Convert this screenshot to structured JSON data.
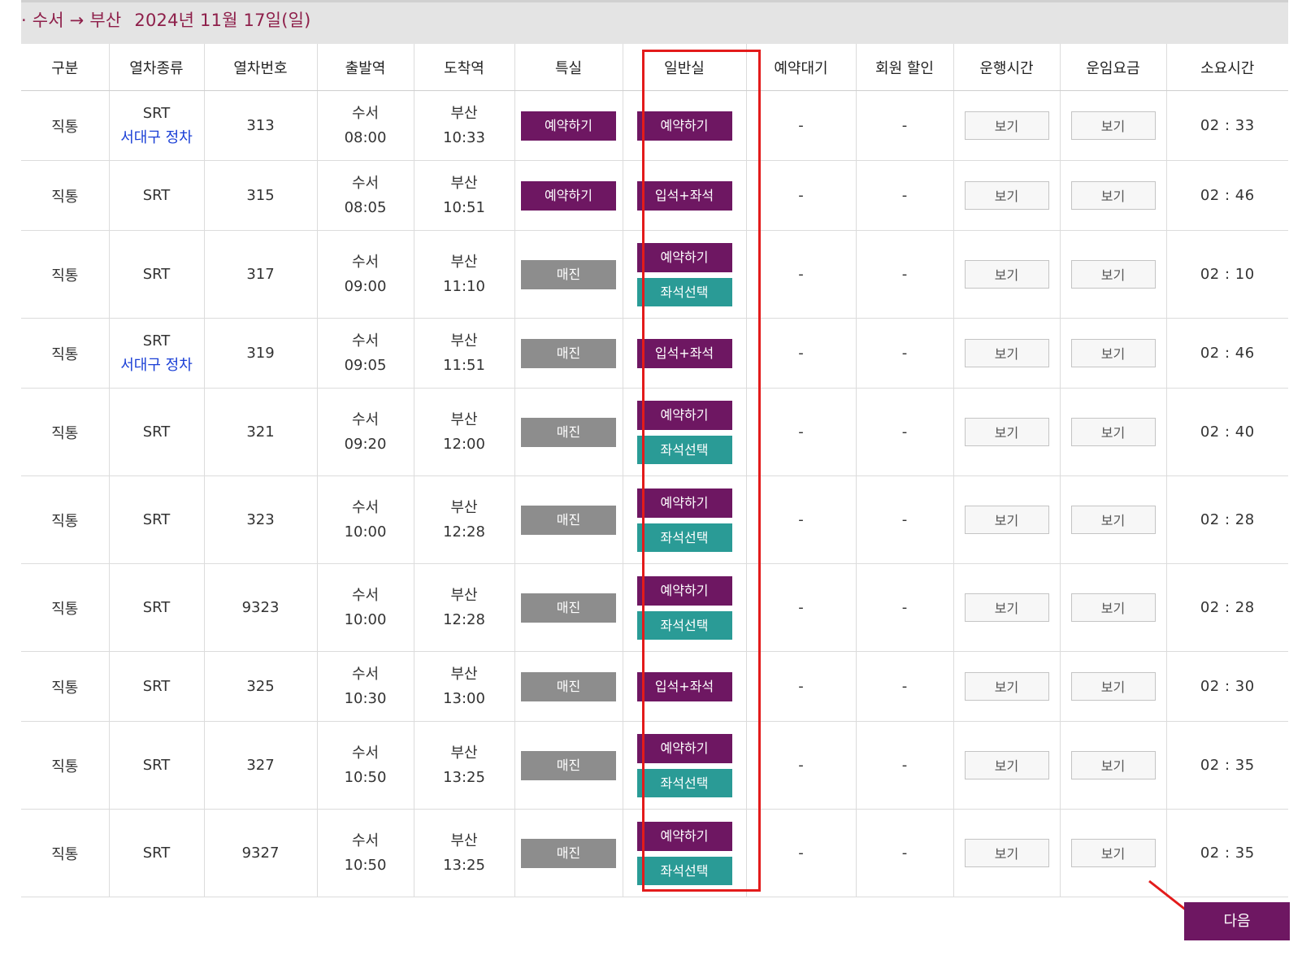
{
  "header": {
    "route": "· 수서 → 부산",
    "date": "2024년 11월 17일(일)"
  },
  "columns": [
    "구분",
    "열차종류",
    "열차번호",
    "출발역",
    "도착역",
    "특실",
    "일반실",
    "예약대기",
    "회원 할인",
    "운행시간",
    "운임요금",
    "소요시간"
  ],
  "rows": [
    {
      "category": "직통",
      "train_type": "SRT",
      "stopover": "서대구 정차",
      "number": "313",
      "dep_station": "수서",
      "dep_time": "08:00",
      "arr_station": "부산",
      "arr_time": "10:33",
      "special": "예약하기",
      "general": "예약하기",
      "general_seat": "",
      "waitlist": "-",
      "discount": "-",
      "schedule": "보기",
      "fare": "보기",
      "duration": "02 : 33"
    },
    {
      "category": "직통",
      "train_type": "SRT",
      "stopover": "",
      "number": "315",
      "dep_station": "수서",
      "dep_time": "08:05",
      "arr_station": "부산",
      "arr_time": "10:51",
      "special": "예약하기",
      "general": "입석+좌석",
      "general_seat": "",
      "waitlist": "-",
      "discount": "-",
      "schedule": "보기",
      "fare": "보기",
      "duration": "02 : 46"
    },
    {
      "category": "직통",
      "train_type": "SRT",
      "stopover": "",
      "number": "317",
      "dep_station": "수서",
      "dep_time": "09:00",
      "arr_station": "부산",
      "arr_time": "11:10",
      "special": "매진",
      "general": "예약하기",
      "general_seat": "좌석선택",
      "waitlist": "-",
      "discount": "-",
      "schedule": "보기",
      "fare": "보기",
      "duration": "02 : 10"
    },
    {
      "category": "직통",
      "train_type": "SRT",
      "stopover": "서대구 정차",
      "number": "319",
      "dep_station": "수서",
      "dep_time": "09:05",
      "arr_station": "부산",
      "arr_time": "11:51",
      "special": "매진",
      "general": "입석+좌석",
      "general_seat": "",
      "waitlist": "-",
      "discount": "-",
      "schedule": "보기",
      "fare": "보기",
      "duration": "02 : 46"
    },
    {
      "category": "직통",
      "train_type": "SRT",
      "stopover": "",
      "number": "321",
      "dep_station": "수서",
      "dep_time": "09:20",
      "arr_station": "부산",
      "arr_time": "12:00",
      "special": "매진",
      "general": "예약하기",
      "general_seat": "좌석선택",
      "waitlist": "-",
      "discount": "-",
      "schedule": "보기",
      "fare": "보기",
      "duration": "02 : 40"
    },
    {
      "category": "직통",
      "train_type": "SRT",
      "stopover": "",
      "number": "323",
      "dep_station": "수서",
      "dep_time": "10:00",
      "arr_station": "부산",
      "arr_time": "12:28",
      "special": "매진",
      "general": "예약하기",
      "general_seat": "좌석선택",
      "waitlist": "-",
      "discount": "-",
      "schedule": "보기",
      "fare": "보기",
      "duration": "02 : 28"
    },
    {
      "category": "직통",
      "train_type": "SRT",
      "stopover": "",
      "number": "9323",
      "dep_station": "수서",
      "dep_time": "10:00",
      "arr_station": "부산",
      "arr_time": "12:28",
      "special": "매진",
      "general": "예약하기",
      "general_seat": "좌석선택",
      "waitlist": "-",
      "discount": "-",
      "schedule": "보기",
      "fare": "보기",
      "duration": "02 : 28"
    },
    {
      "category": "직통",
      "train_type": "SRT",
      "stopover": "",
      "number": "325",
      "dep_station": "수서",
      "dep_time": "10:30",
      "arr_station": "부산",
      "arr_time": "13:00",
      "special": "매진",
      "general": "입석+좌석",
      "general_seat": "",
      "waitlist": "-",
      "discount": "-",
      "schedule": "보기",
      "fare": "보기",
      "duration": "02 : 30"
    },
    {
      "category": "직통",
      "train_type": "SRT",
      "stopover": "",
      "number": "327",
      "dep_station": "수서",
      "dep_time": "10:50",
      "arr_station": "부산",
      "arr_time": "13:25",
      "special": "매진",
      "general": "예약하기",
      "general_seat": "좌석선택",
      "waitlist": "-",
      "discount": "-",
      "schedule": "보기",
      "fare": "보기",
      "duration": "02 : 35"
    },
    {
      "category": "직통",
      "train_type": "SRT",
      "stopover": "",
      "number": "9327",
      "dep_station": "수서",
      "dep_time": "10:50",
      "arr_station": "부산",
      "arr_time": "13:25",
      "special": "매진",
      "general": "예약하기",
      "general_seat": "좌석선택",
      "waitlist": "-",
      "discount": "-",
      "schedule": "보기",
      "fare": "보기",
      "duration": "02 : 35"
    }
  ],
  "next_button": "다음",
  "colors": {
    "brand_purple": "#6e1762",
    "soldout_gray": "#8d8d8d",
    "seat_teal": "#2a9b96",
    "route_text": "#8e1f4a",
    "stopover_blue": "#1a3fd6",
    "highlight_red": "#e31b1b"
  }
}
